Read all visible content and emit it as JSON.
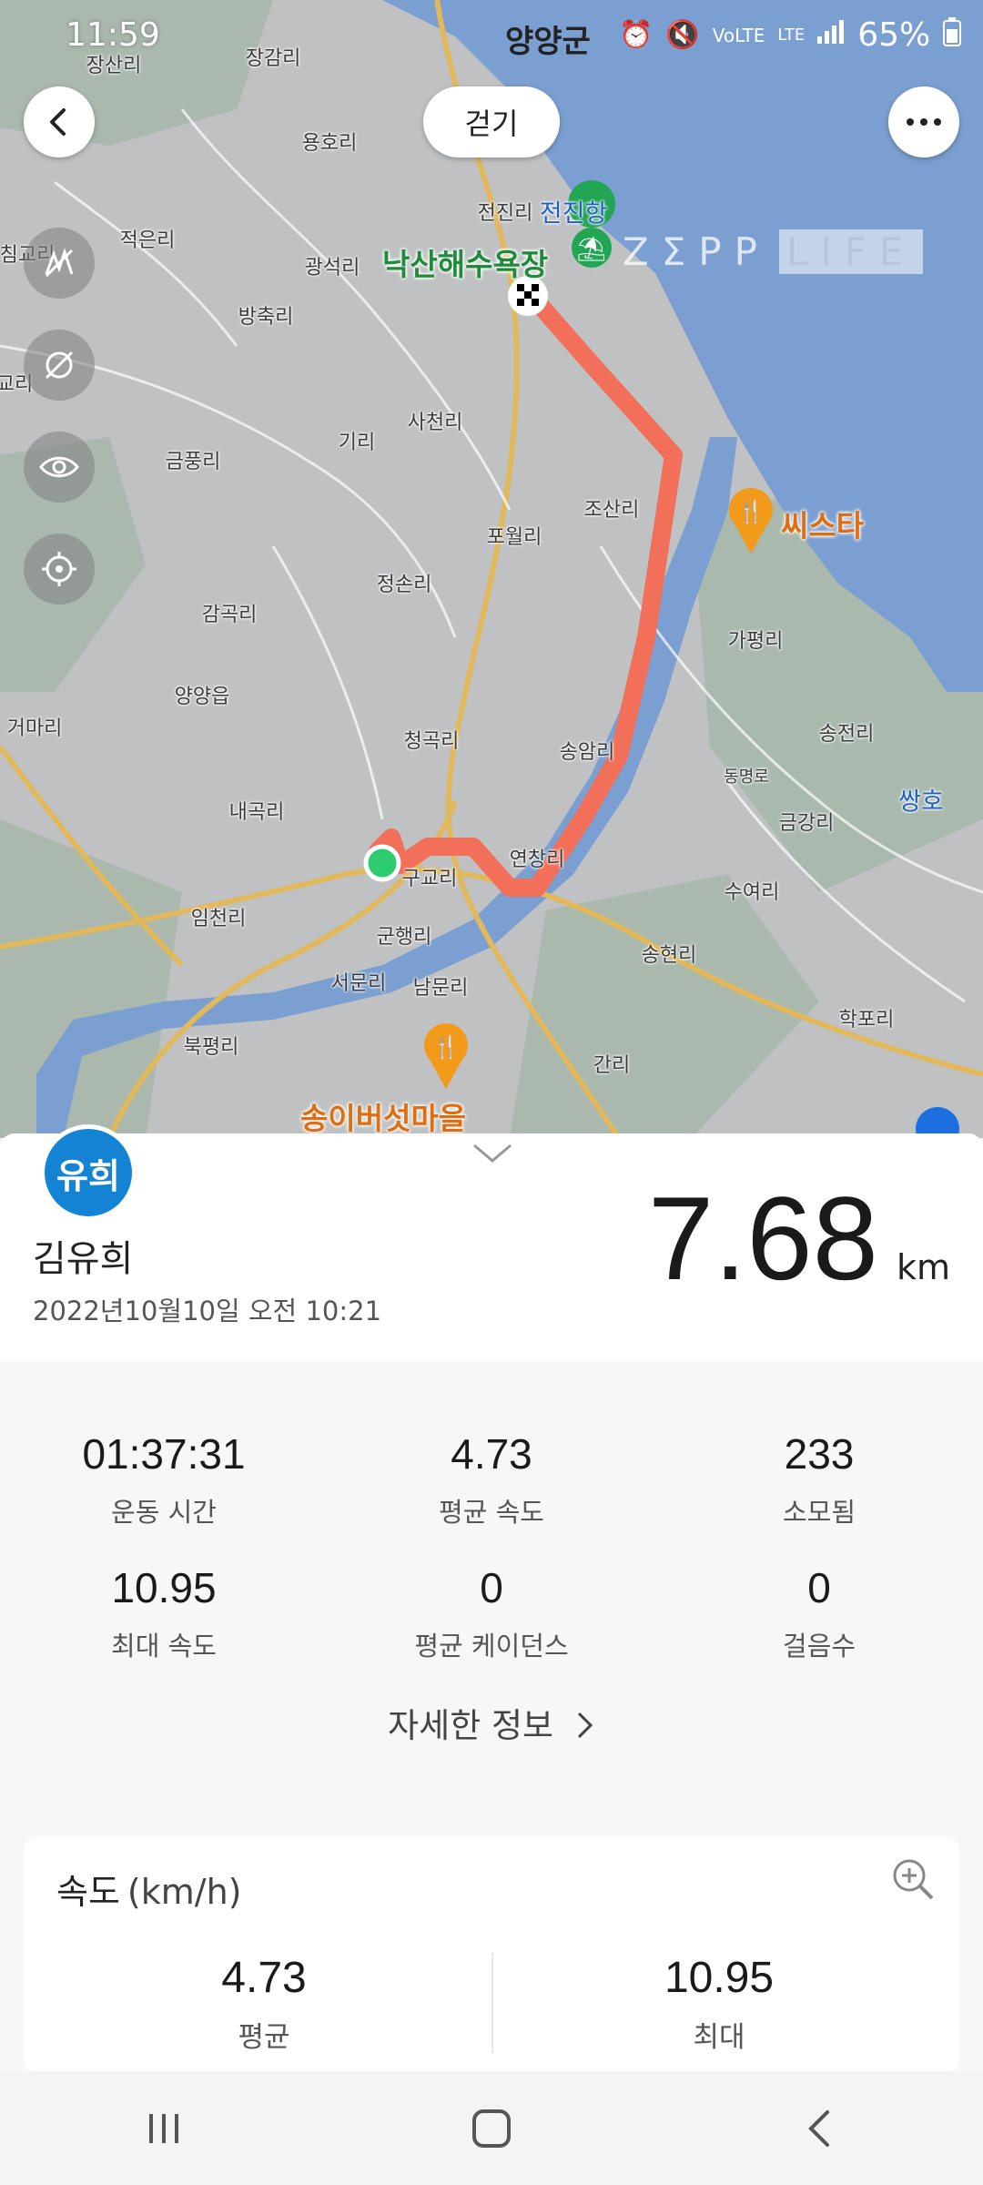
{
  "status_bar": {
    "time": "11:59",
    "location": "양양군",
    "network": "LTE",
    "battery": "65%"
  },
  "map": {
    "activity_type": "걷기",
    "watermark_brand": "ZΣPP",
    "watermark_suffix": "LIFE",
    "poi": {
      "beach": "낙산해수욕장",
      "restaurant1": "씨스타",
      "restaurant2": "송이버섯마을"
    },
    "places": [
      {
        "name": "장산리"
      },
      {
        "name": "장감리"
      },
      {
        "name": "용호리"
      },
      {
        "name": "전진리"
      },
      {
        "name": "전진항"
      },
      {
        "name": "적은리"
      },
      {
        "name": "광석리"
      },
      {
        "name": "방축리"
      },
      {
        "name": "사천리"
      },
      {
        "name": "금풍리"
      },
      {
        "name": "기리"
      },
      {
        "name": "조산리"
      },
      {
        "name": "포월리"
      },
      {
        "name": "정손리"
      },
      {
        "name": "감곡리"
      },
      {
        "name": "가평리"
      },
      {
        "name": "양양읍"
      },
      {
        "name": "거마리"
      },
      {
        "name": "청곡리"
      },
      {
        "name": "송암리"
      },
      {
        "name": "송전리"
      },
      {
        "name": "쌍호"
      },
      {
        "name": "내곡리"
      },
      {
        "name": "동명로"
      },
      {
        "name": "금강리"
      },
      {
        "name": "연창리"
      },
      {
        "name": "구교리"
      },
      {
        "name": "수여리"
      },
      {
        "name": "임천리"
      },
      {
        "name": "군행리"
      },
      {
        "name": "송현리"
      },
      {
        "name": "서문리"
      },
      {
        "name": "남문리"
      },
      {
        "name": "학포리"
      },
      {
        "name": "북평리"
      },
      {
        "name": "간리"
      },
      {
        "name": "침교리"
      },
      {
        "name": "교리"
      }
    ]
  },
  "summary": {
    "avatar_text": "유희",
    "user_name": "김유희",
    "date": "2022년10월10일 오전 10:21",
    "distance": "7.68",
    "distance_unit": "km"
  },
  "stats": [
    {
      "value": "01:37:31",
      "label": "운동 시간"
    },
    {
      "value": "4.73",
      "label": "평균 속도"
    },
    {
      "value": "233",
      "label": "소모됨"
    },
    {
      "value": "10.95",
      "label": "최대 속도"
    },
    {
      "value": "0",
      "label": "평균 케이던스"
    },
    {
      "value": "0",
      "label": "걸음수"
    }
  ],
  "detail_link": "자세한 정보",
  "speed_card": {
    "title": "속도",
    "unit": "(km/h)",
    "avg_value": "4.73",
    "avg_label": "평균",
    "max_value": "10.95",
    "max_label": "최대"
  },
  "colors": {
    "route": "#f26f5a",
    "sea": "#7b9fd0",
    "avatar": "#1583d4",
    "start_point": "#2ecc71"
  }
}
